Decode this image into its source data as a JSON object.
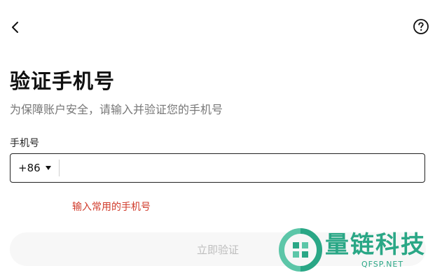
{
  "header": {
    "back_icon": "chevron-left-icon",
    "help_icon": "question-circle-icon"
  },
  "title": "验证手机号",
  "subtitle": "为保障账户安全，请输入并验证您的手机号",
  "phone_field": {
    "label": "手机号",
    "country_code": "+86",
    "value": "",
    "placeholder": ""
  },
  "error_message": "输入常用的手机号",
  "verify_button": {
    "label": "立即验证"
  },
  "watermark": {
    "text": "量链科技",
    "subtext": "QFSP.NET"
  },
  "colors": {
    "error": "#d03a2a",
    "button_bg": "#f7f7f7",
    "button_text": "#bdbdbd",
    "watermark": "#2aa786"
  }
}
